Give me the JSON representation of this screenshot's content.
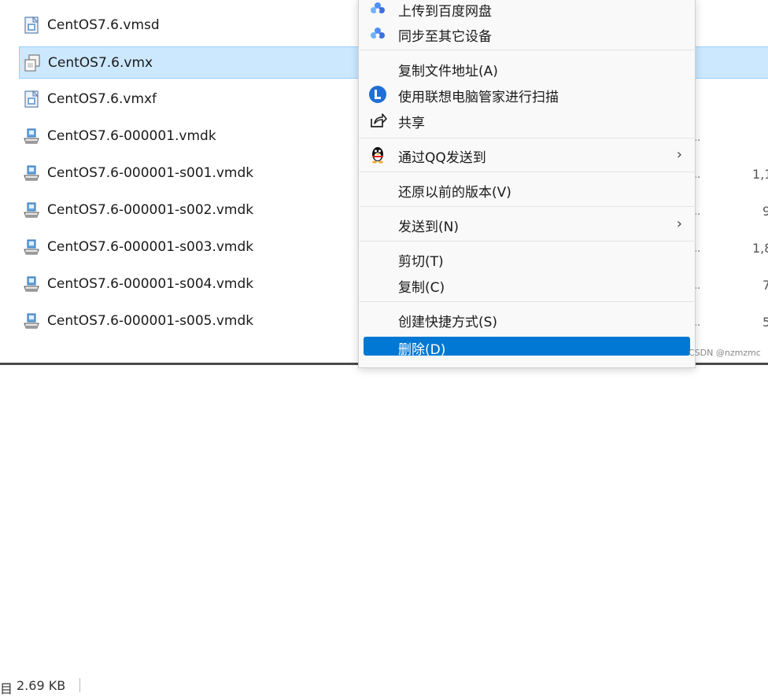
{
  "files": [
    {
      "name": "CentOS7.6.vmsd",
      "icon": "vmware-settings-file-icon",
      "size": ""
    },
    {
      "name": "CentOS7.6.vmx",
      "icon": "vmware-config-file-icon",
      "size": "",
      "selected": true
    },
    {
      "name": "CentOS7.6.vmxf",
      "icon": "vmware-settings-file-icon",
      "size": ""
    },
    {
      "name": "CentOS7.6-000001.vmdk",
      "icon": "virtual-disk-icon",
      "size": ""
    },
    {
      "name": "CentOS7.6-000001-s001.vmdk",
      "icon": "virtual-disk-icon",
      "size": "1,1"
    },
    {
      "name": "CentOS7.6-000001-s002.vmdk",
      "icon": "virtual-disk-icon",
      "size": "9"
    },
    {
      "name": "CentOS7.6-000001-s003.vmdk",
      "icon": "virtual-disk-icon",
      "size": "1,8"
    },
    {
      "name": "CentOS7.6-000001-s004.vmdk",
      "icon": "virtual-disk-icon",
      "size": "7"
    },
    {
      "name": "CentOS7.6-000001-s005.vmdk",
      "icon": "virtual-disk-icon",
      "size": "5"
    }
  ],
  "status": {
    "fragment": "目",
    "selected_size": "2.69 KB"
  },
  "menu": {
    "items": [
      {
        "label": "上传到百度网盘",
        "icon": "baidu-cloud-icon"
      },
      {
        "label": "同步至其它设备",
        "icon": "baidu-sync-icon"
      },
      {
        "label": "复制文件地址(A)",
        "icon": ""
      },
      {
        "label": "使用联想电脑管家进行扫描",
        "icon": "lenovo-shield-icon"
      },
      {
        "label": "共享",
        "icon": "share-icon"
      },
      {
        "label": "通过QQ发送到",
        "icon": "qq-penguin-icon",
        "submenu": true
      },
      {
        "label": "还原以前的版本(V)",
        "icon": ""
      },
      {
        "label": "发送到(N)",
        "icon": "",
        "submenu": true
      },
      {
        "label": "剪切(T)",
        "icon": ""
      },
      {
        "label": "复制(C)",
        "icon": ""
      },
      {
        "label": "创建快捷方式(S)",
        "icon": ""
      },
      {
        "label": "删除(D)",
        "icon": "",
        "highlighted": true
      }
    ]
  },
  "watermark": "CSDN @nzmzmc",
  "colors": {
    "selection": "#cce8ff",
    "highlight": "#0078d4"
  }
}
